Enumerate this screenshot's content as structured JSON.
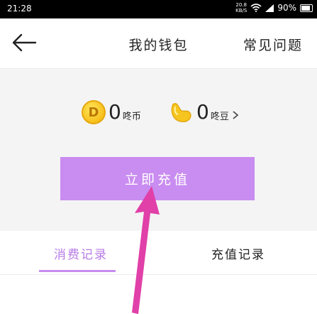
{
  "status_bar": {
    "time": "21:28",
    "speed_value": "20.8",
    "speed_unit": "KB/S",
    "battery": "90%",
    "icons": [
      "wifi-icon",
      "signal-icon",
      "battery-icon"
    ]
  },
  "header": {
    "back_icon": "arrow-left-icon",
    "title": "我的钱包",
    "faq_label": "常见问题"
  },
  "balance": {
    "coin": {
      "icon": "coin-icon",
      "icon_letter": "D",
      "amount": "0",
      "unit": "咚币"
    },
    "bean": {
      "icon": "bean-icon",
      "amount": "0",
      "unit": "咚豆",
      "chevron_icon": "chevron-right-icon"
    }
  },
  "recharge_button": {
    "label": "立即充值"
  },
  "tabs": {
    "items": [
      {
        "label": "消费记录",
        "active": true
      },
      {
        "label": "充值记录",
        "active": false
      }
    ]
  },
  "colors": {
    "accent": "#c98cf0",
    "active_tab": "#b77be6",
    "annotation_arrow": "#e040a8",
    "coin": "#f7c01c",
    "background_section": "#f4f4f4"
  }
}
